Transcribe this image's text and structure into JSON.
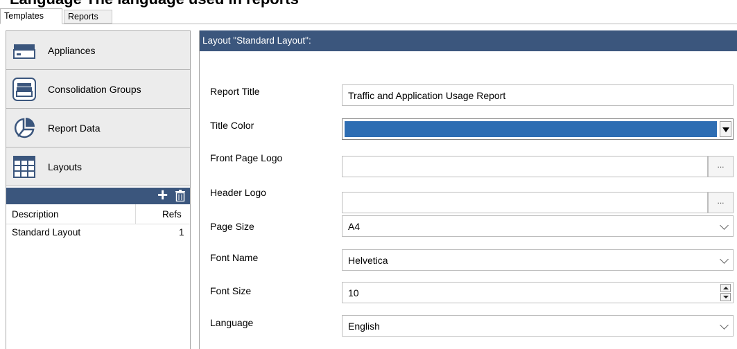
{
  "heading_fragment": "Language   The language used in reports",
  "tabs": [
    {
      "label": "Templates",
      "active": true
    },
    {
      "label": "Reports",
      "active": false
    }
  ],
  "sidebar": {
    "items": [
      {
        "label": "Appliances",
        "icon": "appliance-icon"
      },
      {
        "label": "Consolidation Groups",
        "icon": "consolidation-group-icon"
      },
      {
        "label": "Report Data",
        "icon": "pie-chart-icon"
      },
      {
        "label": "Layouts",
        "icon": "grid-layout-icon"
      }
    ],
    "list": {
      "columns": {
        "description": "Description",
        "refs": "Refs"
      },
      "rows": [
        {
          "description": "Standard Layout",
          "refs": "1"
        }
      ],
      "add_icon": "plus-icon",
      "delete_icon": "trash-icon"
    }
  },
  "main": {
    "header": "Layout \"Standard Layout\":",
    "fields": {
      "report_title": {
        "label": "Report Title",
        "value": "Traffic and Application Usage Report"
      },
      "title_color": {
        "label": "Title Color",
        "value": "#2d6db3"
      },
      "front_page_logo": {
        "label": "Front Page Logo",
        "value": "",
        "browse": "..."
      },
      "header_logo": {
        "label": "Header Logo",
        "value": "",
        "browse": "..."
      },
      "page_size": {
        "label": "Page Size",
        "value": "A4"
      },
      "font_name": {
        "label": "Font Name",
        "value": "Helvetica"
      },
      "font_size": {
        "label": "Font Size",
        "value": "10"
      },
      "language": {
        "label": "Language",
        "value": "English"
      }
    }
  },
  "colors": {
    "header_bar": "#3b567d",
    "title_color_swatch": "#2d6db3",
    "nav_bg": "#ececec"
  }
}
